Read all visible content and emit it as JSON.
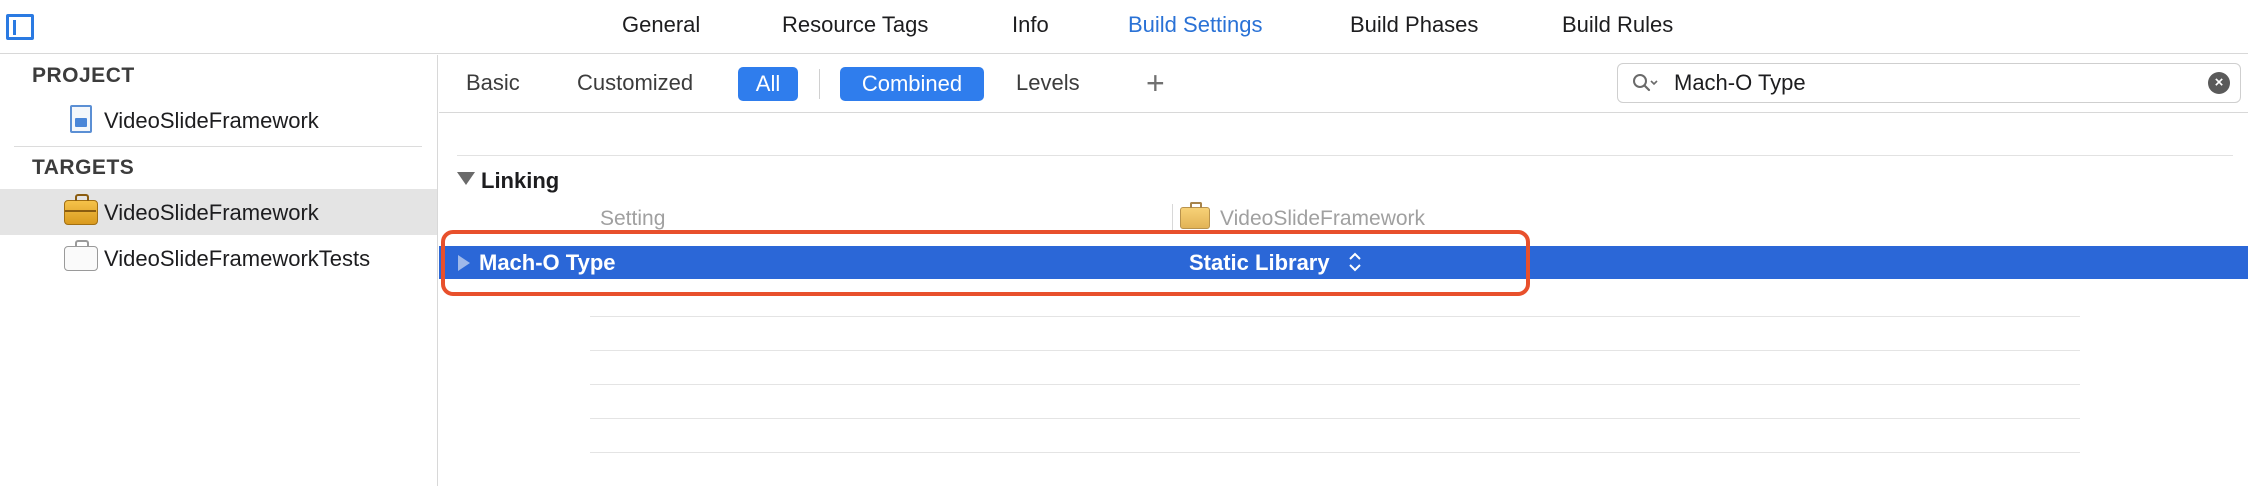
{
  "top_tabs": [
    {
      "label": "General"
    },
    {
      "label": "Resource Tags"
    },
    {
      "label": "Info"
    },
    {
      "label": "Build Settings",
      "active": true
    },
    {
      "label": "Build Phases"
    },
    {
      "label": "Build Rules"
    }
  ],
  "sidebar": {
    "project_header": "PROJECT",
    "project_item": "VideoSlideFramework",
    "targets_header": "TARGETS",
    "targets": [
      {
        "label": "VideoSlideFramework",
        "selected": true,
        "icon": "framework-target-icon"
      },
      {
        "label": "VideoSlideFrameworkTests",
        "selected": false,
        "icon": "test-bundle-icon"
      }
    ]
  },
  "filter_bar": {
    "basic": "Basic",
    "customized": "Customized",
    "all": "All",
    "combined": "Combined",
    "levels": "Levels",
    "add": "+",
    "search_value": "Mach-O Type",
    "clear": "×"
  },
  "content": {
    "section_title": "Linking",
    "col_setting": "Setting",
    "col_target": "VideoSlideFramework",
    "row": {
      "name": "Mach-O Type",
      "value": "Static Library"
    }
  },
  "colors": {
    "accent": "#2f7ded",
    "selection": "#2b67d7",
    "highlight": "#e8502c",
    "active_tab_text": "#2a72d6"
  }
}
